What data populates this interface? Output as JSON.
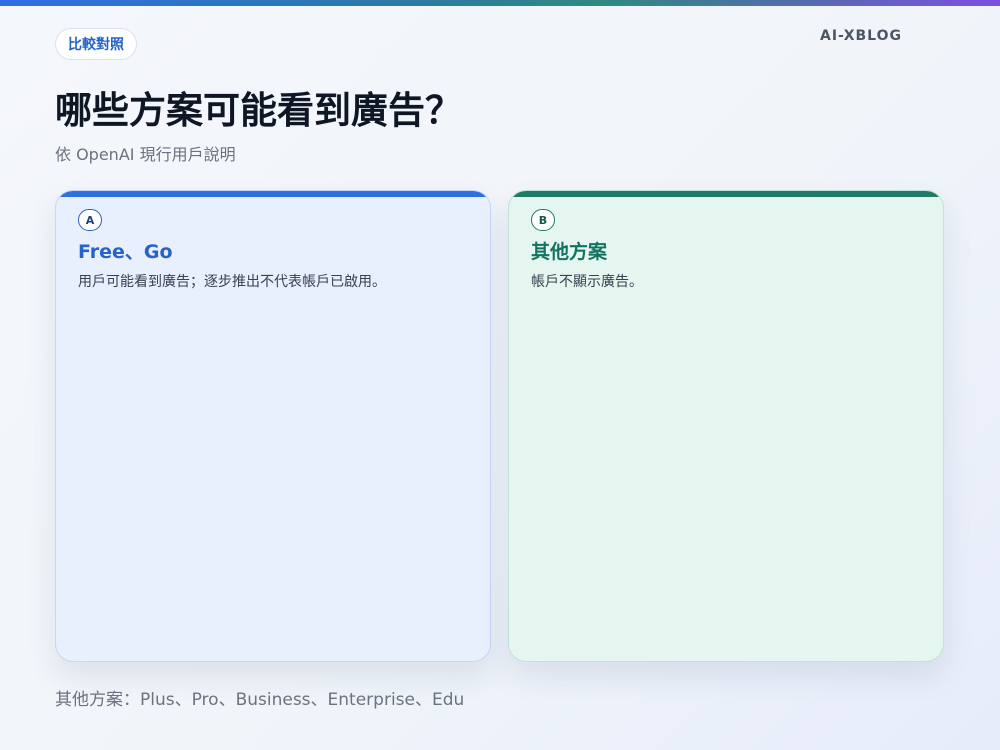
{
  "header": {
    "badge": "比較對照",
    "brand": "AI-XBLOG",
    "title": "哪些方案可能看到廣告？",
    "subtitle": "依 OpenAI 現行用戶說明"
  },
  "cards": [
    {
      "letter": "A",
      "title": "Free、Go",
      "text": "用戶可能看到廣告；逐步推出不代表帳戶已啟用。",
      "accent": "#2f6fe4"
    },
    {
      "letter": "B",
      "title": "其他方案",
      "text": "帳戶不顯示廣告。",
      "accent": "#1f7a66"
    }
  ],
  "footer": "其他方案：Plus、Pro、Business、Enterprise、Edu",
  "colors": {
    "blue_accent": "#2f6fe4",
    "green_accent": "#1f7a66",
    "blue_card_bg": "#e8effd",
    "green_card_bg": "#e5f6f0"
  }
}
